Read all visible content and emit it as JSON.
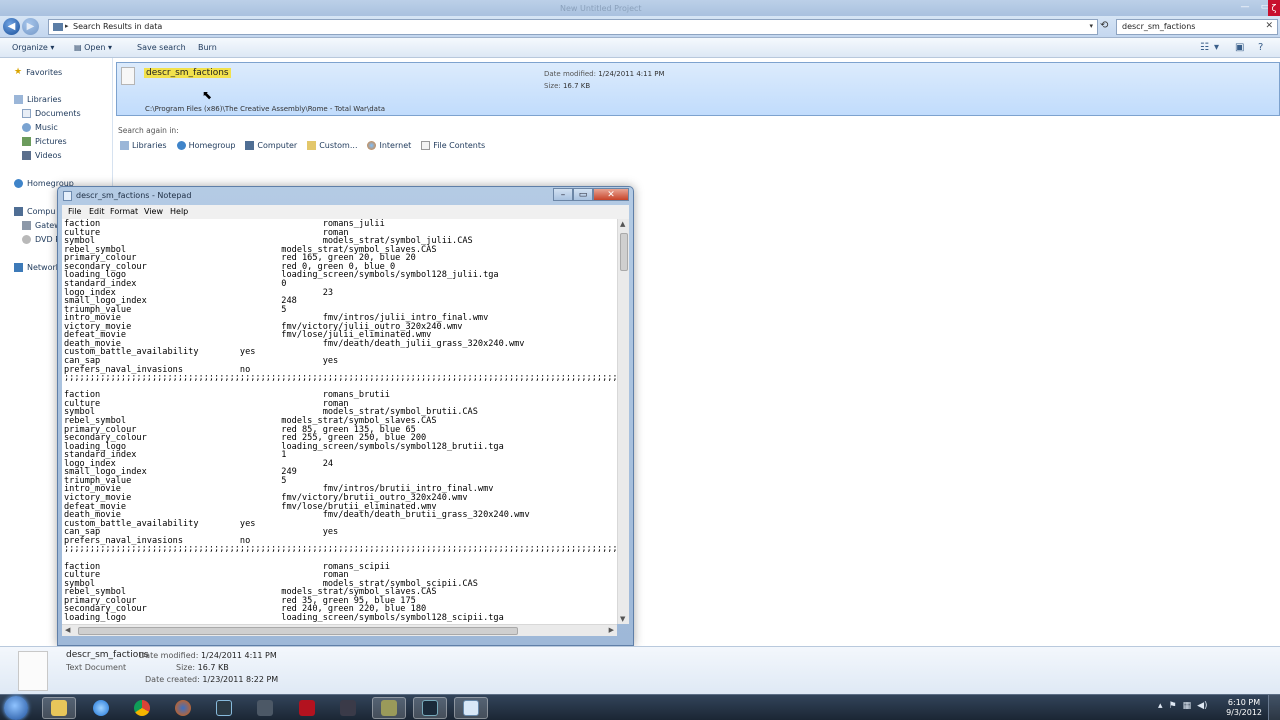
{
  "explorer": {
    "window_title": "New Untitled Project",
    "address": {
      "crumb": "Search Results in data"
    },
    "search": {
      "value": "descr_sm_factions"
    },
    "toolbar": {
      "organize": "Organize",
      "open": "Open",
      "save_search": "Save search",
      "burn": "Burn"
    },
    "nav": {
      "favorites": "Favorites",
      "libraries": "Libraries",
      "documents": "Documents",
      "music": "Music",
      "pictures": "Pictures",
      "videos": "Videos",
      "homegroup": "Homegroup",
      "computer": "Compu",
      "gateway": "Gatew",
      "dvd": "DVD R",
      "network": "Network"
    },
    "result": {
      "name": "descr_sm_factions",
      "path": "C:\\Program Files (x86)\\The Creative Assembly\\Rome - Total War\\data",
      "date_modified_label": "Date modified:",
      "date_modified": "1/24/2011 4:11 PM",
      "size_label": "Size:",
      "size": "16.7 KB"
    },
    "search_again": {
      "label": "Search again in:",
      "items": [
        "Libraries",
        "Homegroup",
        "Computer",
        "Custom...",
        "Internet",
        "File Contents"
      ]
    },
    "details": {
      "name": "descr_sm_factions",
      "type": "Text Document",
      "date_modified_label": "Date modified:",
      "date_modified": "1/24/2011 4:11 PM",
      "size_label": "Size:",
      "size": "16.7 KB",
      "date_created_label": "Date created:",
      "date_created": "1/23/2011 8:22 PM"
    }
  },
  "notepad": {
    "title": "descr_sm_factions - Notepad",
    "menu": [
      "File",
      "Edit",
      "Format",
      "View",
      "Help"
    ],
    "content": "faction                                           romans_julii\nculture                                           roman\nsymbol                                            models_strat/symbol_julii.CAS\nrebel_symbol                              models_strat/symbol_slaves.CAS\nprimary_colour                            red 165, green 20, blue 20\nsecondary_colour                          red 0, green 0, blue 0\nloading_logo                              loading_screen/symbols/symbol128_julii.tga\nstandard_index                            0\nlogo_index                                        23\nsmall_logo_index                          248\ntriumph_value                             5\nintro_movie                                       fmv/intros/julii_intro_final.wmv\nvictory_movie                             fmv/victory/julii_outro_320x240.wmv\ndefeat_movie                              fmv/lose/julii_eliminated.wmv\ndeath_movie                                       fmv/death/death_julii_grass_320x240.wmv\ncustom_battle_availability        yes\ncan_sap                                           yes\nprefers_naval_invasions           no\n;;;;;;;;;;;;;;;;;;;;;;;;;;;;;;;;;;;;;;;;;;;;;;;;;;;;;;;;;;;;;;;;;;;;;;;;;;;;;;;;;;;;;;;;;;;;;;;;;;;;;;;;;;;\n\nfaction                                           romans_brutii\nculture                                           roman\nsymbol                                            models_strat/symbol_brutii.CAS\nrebel_symbol                              models_strat/symbol_slaves.CAS\nprimary_colour                            red 85, green 135, blue 65\nsecondary_colour                          red 255, green 250, blue 200\nloading_logo                              loading_screen/symbols/symbol128_brutii.tga\nstandard_index                            1\nlogo_index                                        24\nsmall_logo_index                          249\ntriumph_value                             5\nintro_movie                                       fmv/intros/brutii_intro_final.wmv\nvictory_movie                             fmv/victory/brutii_outro_320x240.wmv\ndefeat_movie                              fmv/lose/brutii_eliminated.wmv\ndeath_movie                                       fmv/death/death_brutii_grass_320x240.wmv\ncustom_battle_availability        yes\ncan_sap                                           yes\nprefers_naval_invasions           no\n;;;;;;;;;;;;;;;;;;;;;;;;;;;;;;;;;;;;;;;;;;;;;;;;;;;;;;;;;;;;;;;;;;;;;;;;;;;;;;;;;;;;;;;;;;;;;;;;;;;;;;;;;;;\n\nfaction                                           romans_scipii\nculture                                           roman\nsymbol                                            models_strat/symbol_scipii.CAS\nrebel_symbol                              models_strat/symbol_slaves.CAS\nprimary_colour                            red 35, green 95, blue 175\nsecondary_colour                          red 240, green 220, blue 180\nloading_logo                              loading_screen/symbols/symbol128_scipii.tga"
  },
  "taskbar": {
    "time": "6:10 PM",
    "date": "9/3/2012",
    "apps": [
      "explorer-icon",
      "internet-explorer-icon",
      "chrome-icon",
      "firefox-icon",
      "terminal-icon",
      "steam-icon",
      "total-war-icon",
      "media-icon",
      "game-icon",
      "monitor-icon",
      "notepad-icon"
    ]
  },
  "colors": {
    "selection": "#c1dcfc",
    "highlight": "#f2e14c",
    "taskbar": "#1b2634"
  }
}
